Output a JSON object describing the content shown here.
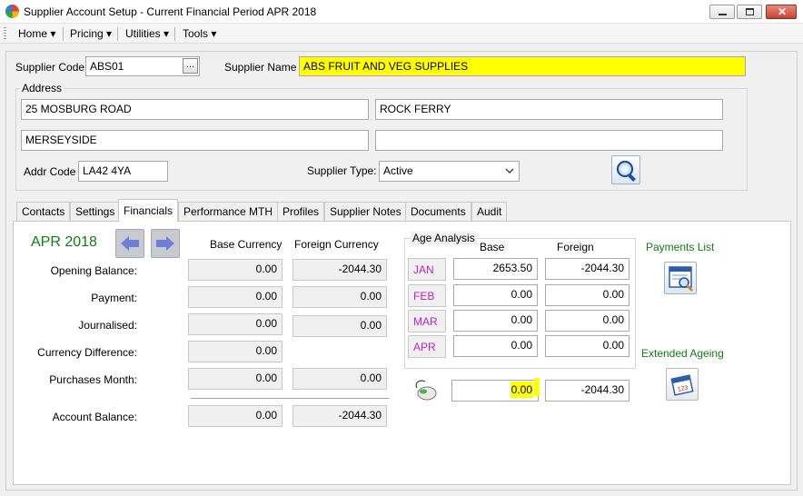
{
  "window": {
    "title": "Supplier Account Setup - Current Financial Period APR 2018"
  },
  "menu": [
    {
      "label": "Home"
    },
    {
      "label": "Pricing"
    },
    {
      "label": "Utilities"
    },
    {
      "label": "Tools"
    }
  ],
  "supplier": {
    "code_label": "Supplier Code",
    "code_value": "ABS01",
    "lookup_label": "...",
    "name_label": "Supplier Name",
    "name_value": "ABS  FRUIT AND VEG SUPPLIES"
  },
  "address": {
    "group_label": "Address",
    "line1": "25 MOSBURG ROAD",
    "line2": "ROCK FERRY",
    "line3": "MERSEYSIDE",
    "line4": "",
    "addr_code_label": "Addr Code",
    "addr_code_value": "LA42 4YA",
    "supplier_type_label": "Supplier Type:",
    "supplier_type_value": "Active"
  },
  "tabs": [
    {
      "label": "Contacts"
    },
    {
      "label": "Settings"
    },
    {
      "label": "Financials"
    },
    {
      "label": "Performance MTH"
    },
    {
      "label": "Profiles"
    },
    {
      "label": "Supplier Notes"
    },
    {
      "label": "Documents"
    },
    {
      "label": "Audit"
    }
  ],
  "financials": {
    "period": "APR 2018",
    "base_header": "Base Currency",
    "foreign_header": "Foreign Currency",
    "rows": [
      {
        "label": "Opening Balance:",
        "base": "0.00",
        "foreign": "-2044.30"
      },
      {
        "label": "Payment:",
        "base": "0.00",
        "foreign": "0.00"
      },
      {
        "label": "Journalised:",
        "base": "0.00",
        "foreign": "0.00"
      },
      {
        "label": "Currency Difference:",
        "base": "0.00"
      },
      {
        "label": "Purchases Month:",
        "base": "0.00",
        "foreign": "0.00"
      }
    ],
    "account_balance": {
      "label": "Account Balance:",
      "base": "0.00",
      "foreign": "-2044.30"
    }
  },
  "age_analysis": {
    "title": "Age Analysis",
    "base_header": "Base",
    "foreign_header": "Foreign",
    "rows": [
      {
        "month": "JAN",
        "base": "2653.50",
        "foreign": "-2044.30"
      },
      {
        "month": "FEB",
        "base": "0.00",
        "foreign": "0.00"
      },
      {
        "month": "MAR",
        "base": "0.00",
        "foreign": "0.00"
      },
      {
        "month": "APR",
        "base": "0.00",
        "foreign": "0.00"
      }
    ],
    "total_base": "0.00",
    "total_foreign": "-2044.30"
  },
  "side": {
    "payments_list_label": "Payments List",
    "extended_ageing_label": "Extended Ageing"
  },
  "colors": {
    "highlight": "#ffff00",
    "green_text": "#0f7f12",
    "month_text": "#c020c0"
  },
  "icons": {
    "app": "app-logo-icon",
    "search": "binoculars-search-icon",
    "prev": "arrow-left-icon",
    "next": "arrow-right-icon",
    "payments": "payments-list-icon",
    "ageing": "calendar-ageing-icon",
    "mouse": "mouse-icon"
  }
}
